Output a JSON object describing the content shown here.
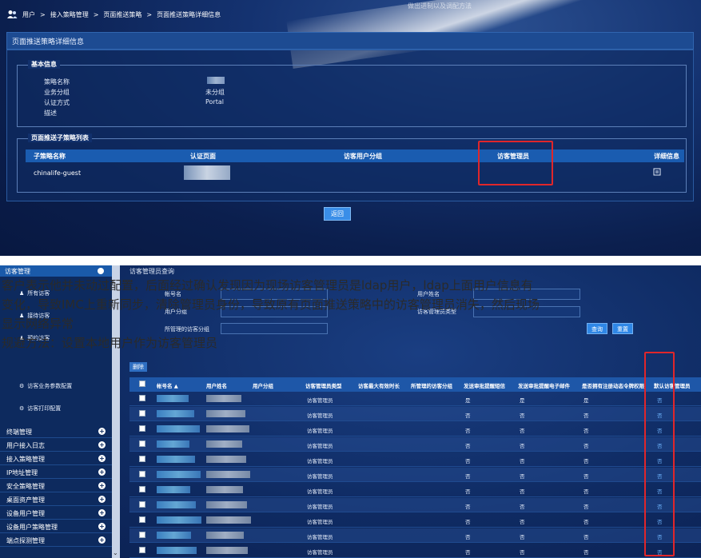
{
  "breadcrumb": [
    "用户",
    ">",
    "接入策略管理",
    ">",
    "页面推送策略",
    ">",
    "页面推送策略详细信息"
  ],
  "top_faded_text": "做出进制以及调配方法",
  "panel_title": "页面推送策略详细信息",
  "basic_info": {
    "legend": "基本信息",
    "rows": [
      {
        "label": "策略名称",
        "value": ""
      },
      {
        "label": "业务分组",
        "value": "未分组"
      },
      {
        "label": "认证方式",
        "value": "Portal"
      },
      {
        "label": "描述",
        "value": ""
      }
    ]
  },
  "sub_policy": {
    "legend": "页面推送子策略列表",
    "headers": [
      "子策略名称",
      "认证页面",
      "访客用户分组",
      "访客管理员",
      "详细信息"
    ],
    "rows": [
      {
        "name": "chinalife-guest"
      }
    ]
  },
  "return_label": "返回",
  "sidebar": {
    "header": "访客管理",
    "subitems": [
      "所有访客",
      "接待访客",
      "预约访客",
      "访客业务参数配置",
      "访客打印配置"
    ],
    "items": [
      "终端管理",
      "用户接入日志",
      "接入策略管理",
      "IP地址管理",
      "安全策略管理",
      "桌面资产管理",
      "设备用户管理",
      "设备用户策略管理",
      "端点探测管理"
    ]
  },
  "query": {
    "title": "访客管理员查询",
    "labels": [
      "帐号名",
      "用户姓名",
      "用户分组",
      "访客管理员类型",
      "所管理的访客分组"
    ],
    "query_button": "查询",
    "reset_button": "重置"
  },
  "overlay": {
    "line1": "客户表示他并未动过配置，后面经过确认发现因为现场访客管理员是ldap用户，ldap上面用户信息有",
    "line2": "变化，导致IMC上重新同步，清除管理员身份，导致原有页面推送策略中的访客管理员消失，然后现场",
    "line3": "显示网络异常",
    "line4": "规避方法：设置本地用户作为访客管理员"
  },
  "table": {
    "action_label": "删除",
    "headers": [
      "帐号名 ▲",
      "用户姓名",
      "用户分组",
      "访客管理员类型",
      "访客最大有效时长",
      "所管理的访客分组",
      "发送审批提醒短信",
      "发送审批提醒电子邮件",
      "是否拥有注册动态令牌权限",
      "默认访客管理员"
    ],
    "rows": [
      {
        "type": "访客管理员",
        "sms": "是",
        "email": "是",
        "token": "是",
        "default": "否"
      },
      {
        "type": "访客管理员",
        "sms": "否",
        "email": "否",
        "token": "否",
        "default": "否"
      },
      {
        "type": "访客管理员",
        "sms": "否",
        "email": "否",
        "token": "否",
        "default": "否"
      },
      {
        "type": "访客管理员",
        "sms": "否",
        "email": "否",
        "token": "否",
        "default": "否"
      },
      {
        "type": "访客管理员",
        "sms": "否",
        "email": "否",
        "token": "否",
        "default": "否"
      },
      {
        "type": "访客管理员",
        "sms": "否",
        "email": "否",
        "token": "否",
        "default": "否"
      },
      {
        "type": "访客管理员",
        "sms": "否",
        "email": "否",
        "token": "否",
        "default": "否"
      },
      {
        "type": "访客管理员",
        "sms": "否",
        "email": "否",
        "token": "否",
        "default": "否"
      },
      {
        "type": "访客管理员",
        "sms": "否",
        "email": "否",
        "token": "否",
        "default": "否"
      },
      {
        "type": "访客管理员",
        "sms": "否",
        "email": "否",
        "token": "否",
        "default": "否"
      },
      {
        "type": "访客管理员",
        "sms": "否",
        "email": "否",
        "token": "否",
        "default": "否"
      }
    ]
  },
  "colors": {
    "highlight": "#e0262a",
    "header_blue": "#1e57a8",
    "accent": "#2f87e6"
  }
}
